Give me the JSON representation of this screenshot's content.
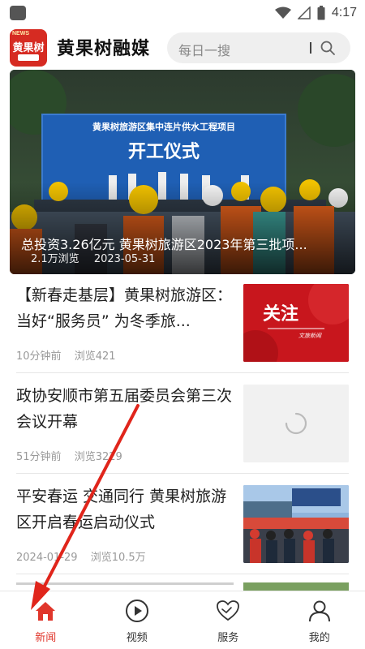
{
  "status_bar": {
    "time": "4:17"
  },
  "header": {
    "logo_top_text": "NEWS",
    "logo_text": "黄果树",
    "app_title": "黄果树融媒",
    "search_placeholder": "每日一搜"
  },
  "hero": {
    "banner_sign_line1": "黄果树旅游区集中连片供水工程项目",
    "banner_sign_line2": "开工仪式",
    "caption": "总投资3.26亿元 黄果树旅游区2023年第三批项...",
    "views": "2.1万浏览",
    "date": "2023-05-31"
  },
  "news": [
    {
      "title": "【新春走基层】黄果树旅游区：当好“服务员” 为冬季旅...",
      "time": "10分钟前",
      "views": "浏览421",
      "thumb_type": "guanzhu",
      "thumb_text": "关注",
      "thumb_subtext": "文旅新闻"
    },
    {
      "title": "政协安顺市第五届委员会第三次会议开幕",
      "time": "51分钟前",
      "views": "浏览3229",
      "thumb_type": "loading"
    },
    {
      "title": "平安春运 交通同行 黄果树旅游区开启春运启动仪式",
      "time": "2024-01-29",
      "views": "浏览10.5万",
      "thumb_type": "photo"
    }
  ],
  "bottom_nav": [
    {
      "label": "新闻",
      "icon": "home-icon",
      "active": true
    },
    {
      "label": "视频",
      "icon": "play-circle-icon",
      "active": false
    },
    {
      "label": "服务",
      "icon": "heart-hand-icon",
      "active": false
    },
    {
      "label": "我的",
      "icon": "user-icon",
      "active": false
    }
  ],
  "colors": {
    "brand_red": "#e0362b",
    "banner_blue": "#1f5fb4"
  }
}
